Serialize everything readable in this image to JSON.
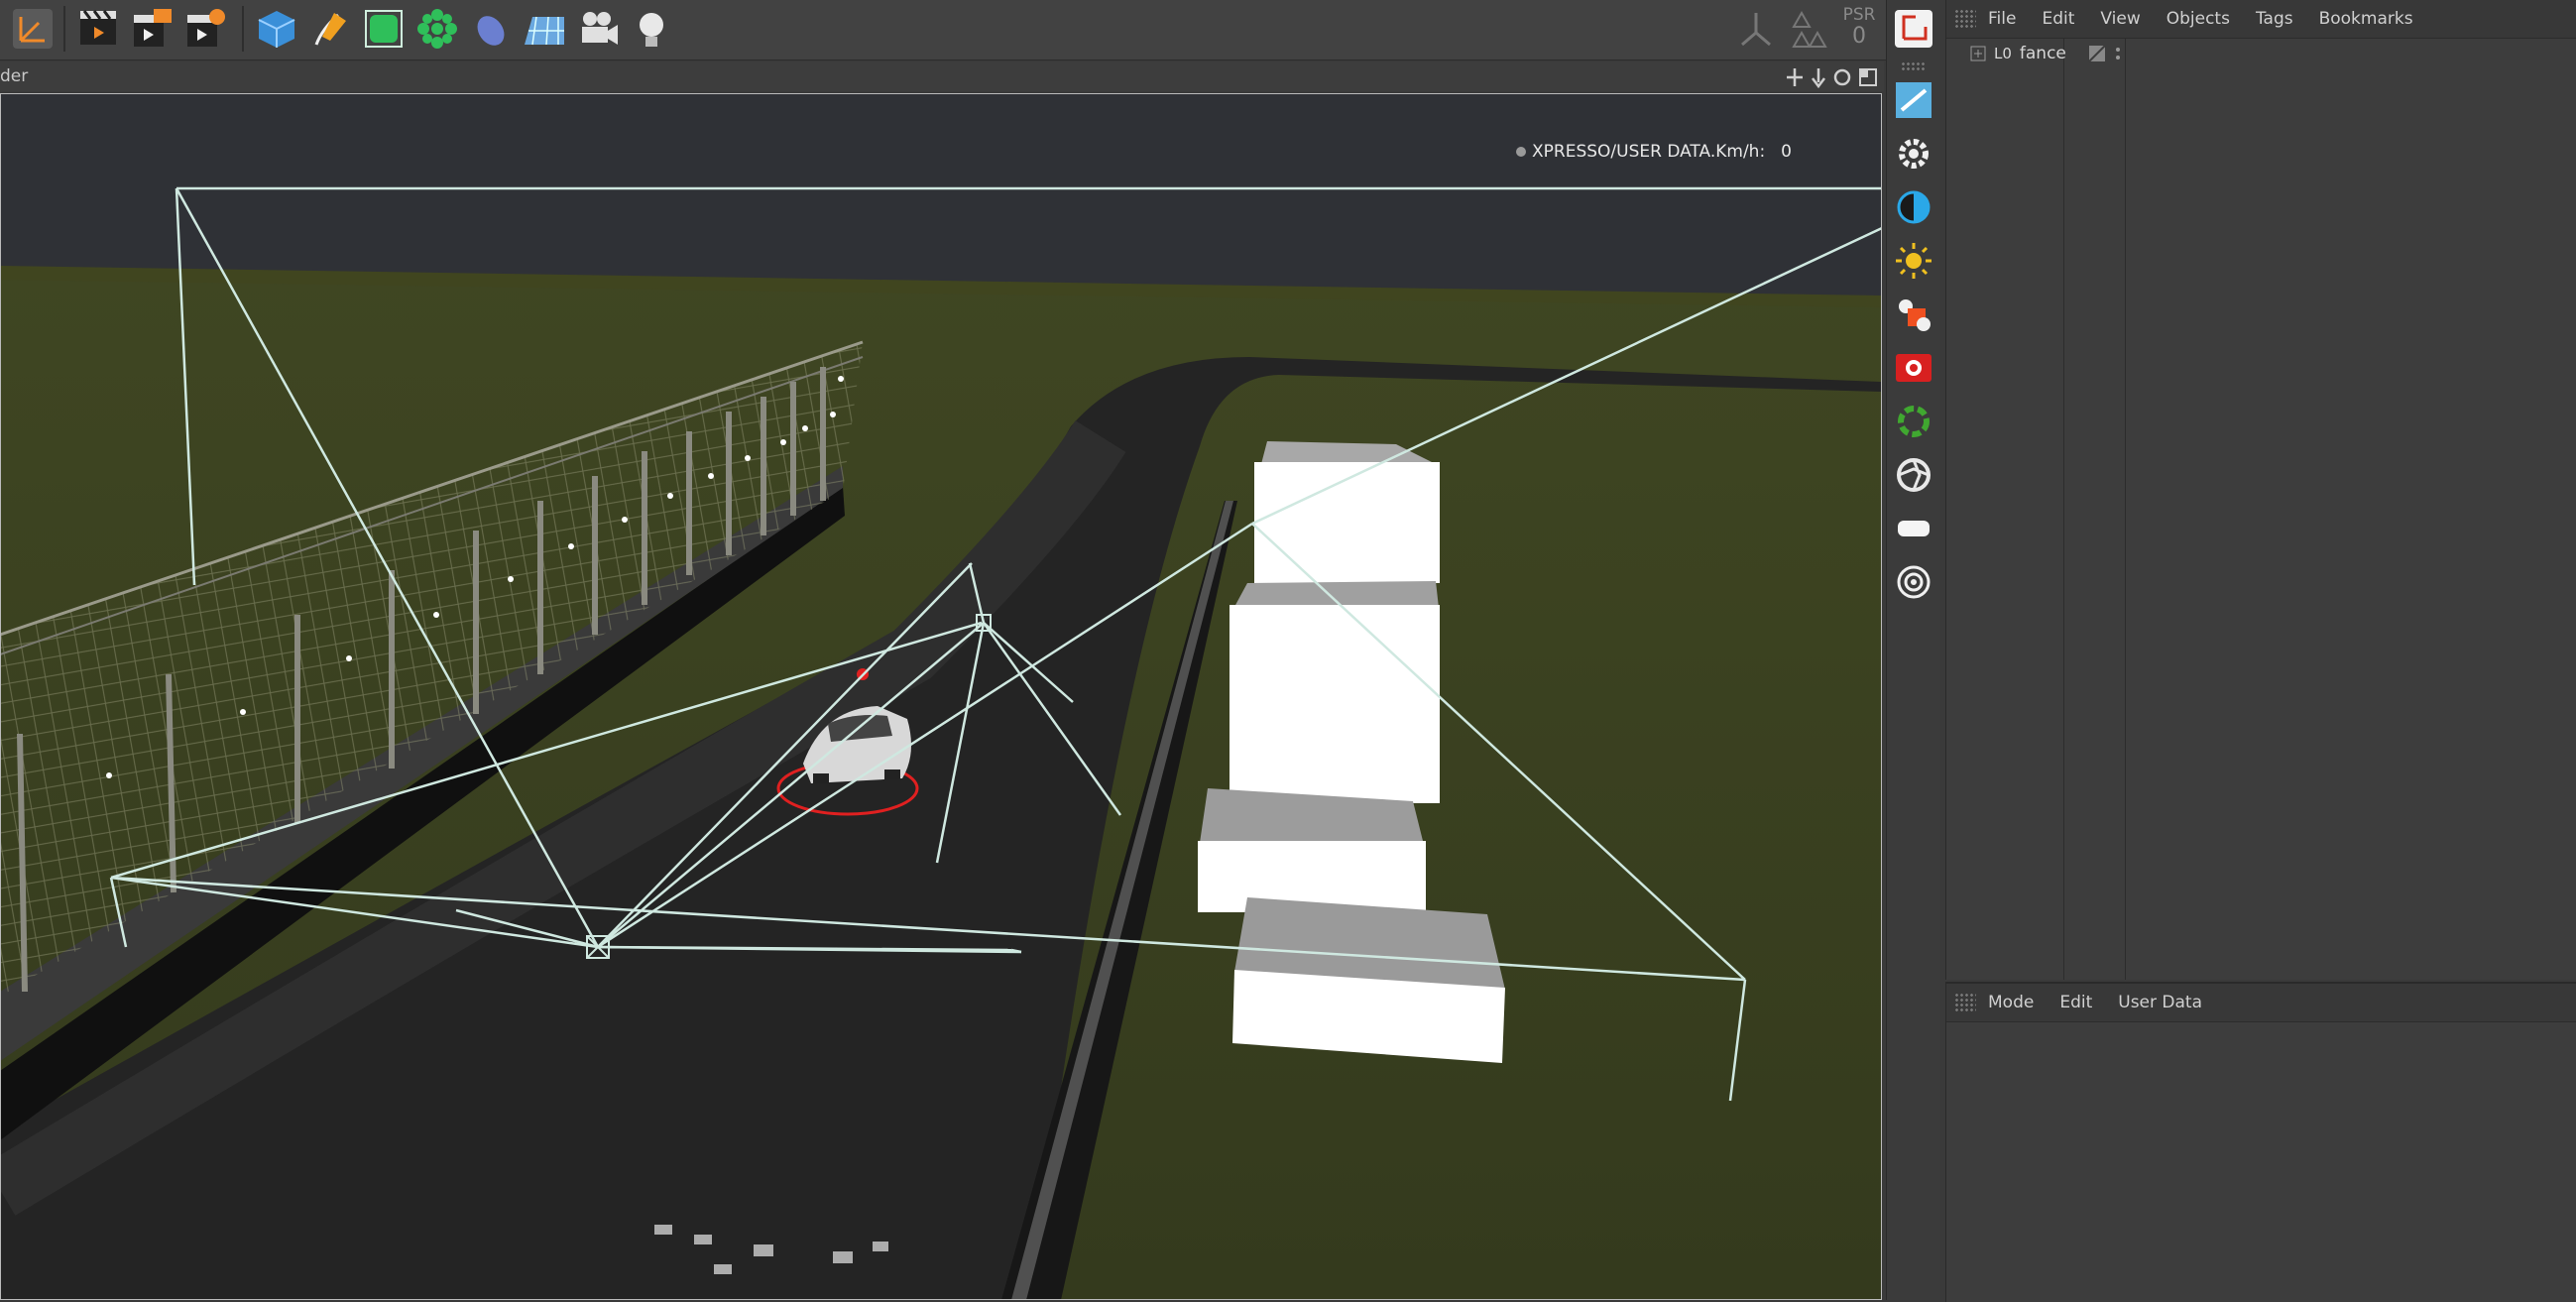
{
  "toolbar": {
    "icons": [
      "coordinate-system-icon",
      "render-view-icon",
      "render-picture-viewer-icon",
      "render-settings-icon",
      "cube-icon",
      "pen-spline-icon",
      "subdivision-icon",
      "cloner-icon",
      "deformer-icon",
      "floor-icon",
      "camera-icon",
      "light-icon"
    ],
    "psr_label": "PSR",
    "psr_value": "0"
  },
  "viewport": {
    "header_label": "der",
    "hud_label": "XPRESSO/USER DATA.Km/h:",
    "hud_value": "0"
  },
  "object_manager": {
    "menu": [
      "File",
      "Edit",
      "View",
      "Objects",
      "Tags",
      "Bookmarks"
    ],
    "objects": [
      {
        "layer": "L0",
        "name": "fance"
      }
    ]
  },
  "attribute_manager": {
    "menu": [
      "Mode",
      "Edit",
      "User Data"
    ]
  },
  "colors": {
    "ground": "#3b4220",
    "road": "#222222",
    "sky": "#2f3136",
    "wire": "#cfe8e0",
    "accent_red": "#e02020"
  }
}
